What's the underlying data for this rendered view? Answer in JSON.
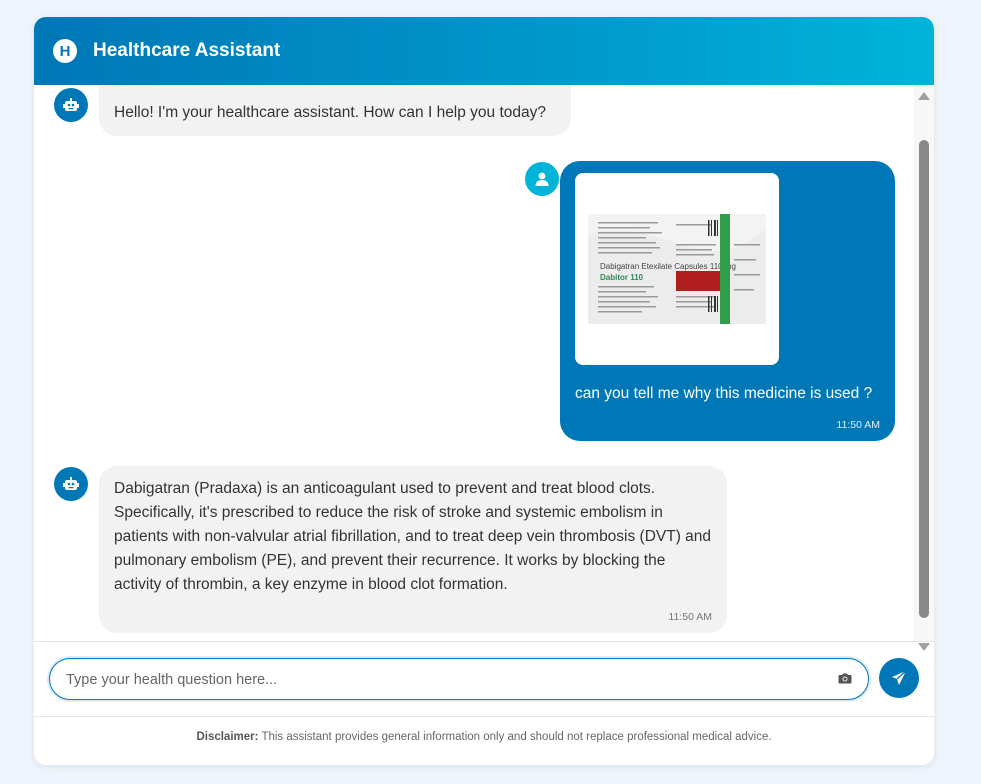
{
  "header": {
    "logo_letter": "H",
    "title": "Healthcare Assistant"
  },
  "messages": [
    {
      "role": "bot",
      "text": "Hello! I'm your healthcare assistant. How can I help you today?"
    },
    {
      "role": "user",
      "image": {
        "title": "Dabigatran Etexilate Capsules 110 mg",
        "brand": "Dabitor 110"
      },
      "text": "can you tell me why this medicine is used ?",
      "time": "11:50 AM"
    },
    {
      "role": "bot",
      "text": "Dabigatran (Pradaxa) is an anticoagulant used to prevent and treat blood clots. Specifically, it's prescribed to reduce the risk of stroke and systemic embolism in patients with non-valvular atrial fibrillation, and to treat deep vein thrombosis (DVT) and pulmonary embolism (PE), and prevent their recurrence. It works by blocking the activity of thrombin, a key enzyme in blood clot formation.",
      "time": "11:50 AM"
    }
  ],
  "input": {
    "placeholder": "Type your health question here..."
  },
  "disclaimer": {
    "label": "Disclaimer:",
    "text": " This assistant provides general information only and should not replace professional medical advice."
  },
  "colors": {
    "primary": "#0077b6",
    "accent": "#00b4d8",
    "bot_bubble": "#f2f2f2"
  }
}
